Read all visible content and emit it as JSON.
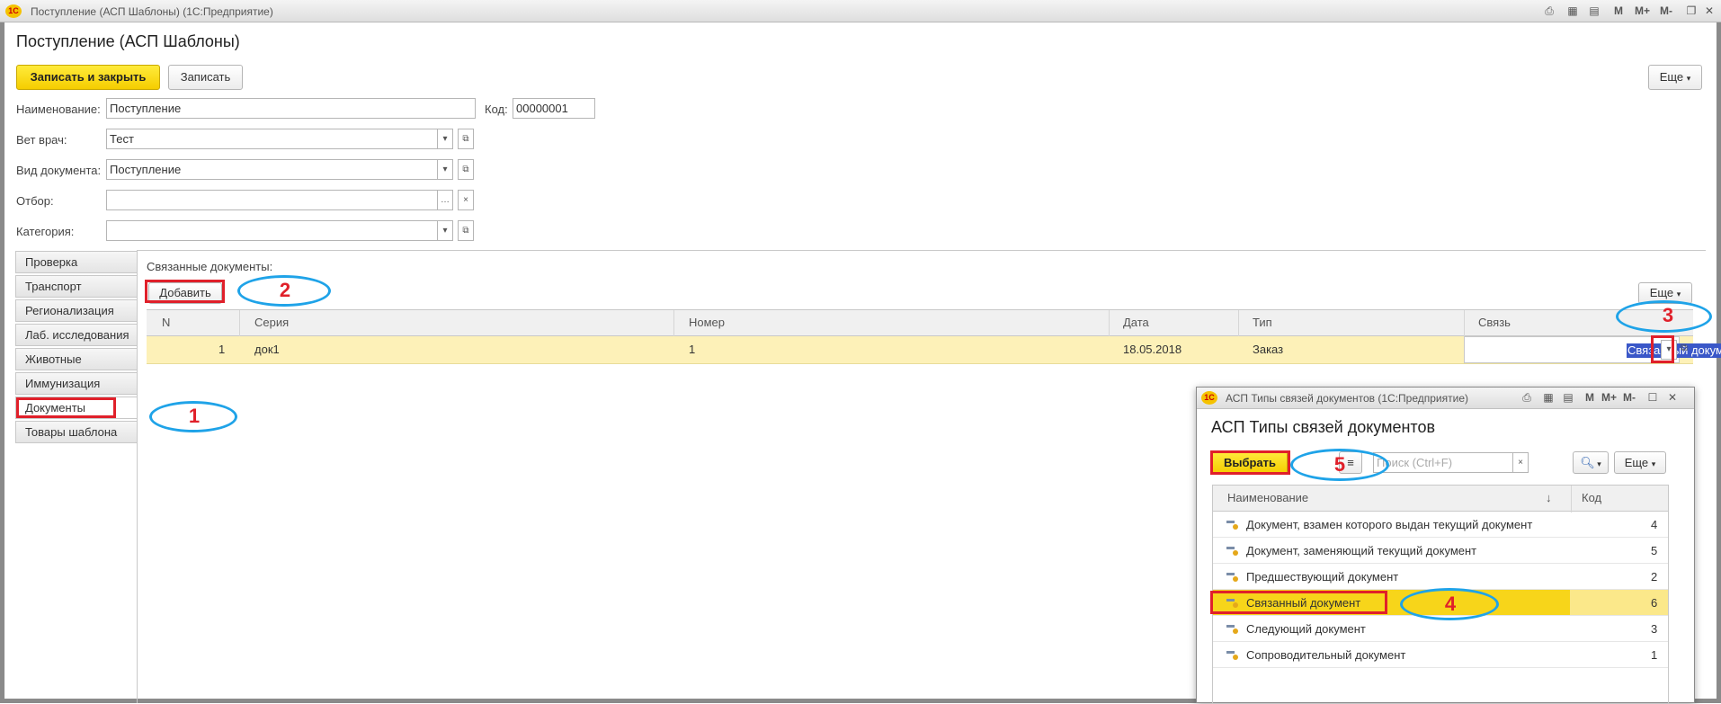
{
  "window": {
    "title": "Поступление (АСП Шаблоны)  (1С:Предприятие)",
    "logo": "1С",
    "toolbar_icons": [
      "print-icon",
      "calculator-icon",
      "calendar-icon"
    ],
    "m_buttons": [
      "M",
      "M+",
      "M-"
    ]
  },
  "form": {
    "title": "Поступление (АСП Шаблоны)",
    "save_close_label": "Записать и закрыть",
    "save_label": "Записать",
    "more_label": "Еще",
    "fields": {
      "name_label": "Наименование:",
      "name_value": "Поступление",
      "code_label": "Код:",
      "code_value": "00000001",
      "vet_label": "Вет врач:",
      "vet_value": "Тест",
      "doctype_label": "Вид документа:",
      "doctype_value": "Поступление",
      "filter_label": "Отбор:",
      "filter_value": "",
      "category_label": "Категория:",
      "category_value": ""
    }
  },
  "sidebar": {
    "items": [
      {
        "label": "Проверка"
      },
      {
        "label": "Транспорт"
      },
      {
        "label": "Регионализация"
      },
      {
        "label": "Лаб. исследования"
      },
      {
        "label": "Животные"
      },
      {
        "label": "Иммунизация"
      },
      {
        "label": "Документы"
      },
      {
        "label": "Товары шаблона"
      }
    ],
    "active_index": 6
  },
  "linked": {
    "section_label": "Связанные документы:",
    "add_label": "Добавить",
    "more_label": "Еще",
    "columns": [
      "N",
      "Серия",
      "Номер",
      "Дата",
      "Тип",
      "Связь"
    ],
    "rows": [
      {
        "n": "1",
        "series": "док1",
        "number": "1",
        "date": "18.05.2018",
        "type": "Заказ",
        "link": "Связанный документ"
      }
    ]
  },
  "popup": {
    "window_title": "АСП Типы связей документов  (1С:Предприятие)",
    "title": "АСП Типы связей документов",
    "select_label": "Выбрать",
    "search_placeholder": "Поиск (Ctrl+F)",
    "more_label": "Еще",
    "columns": [
      "Наименование",
      "Код"
    ],
    "sort_indicator": "↓",
    "items": [
      {
        "name": "Документ, взамен которого выдан текущий документ",
        "code": "4"
      },
      {
        "name": "Документ, заменяющий текущий документ",
        "code": "5"
      },
      {
        "name": "Предшествующий документ",
        "code": "2"
      },
      {
        "name": "Связанный документ",
        "code": "6"
      },
      {
        "name": "Следующий документ",
        "code": "3"
      },
      {
        "name": "Сопроводительный документ",
        "code": "1"
      }
    ],
    "selected_index": 3
  },
  "annotations": {
    "numbers": [
      "1",
      "2",
      "3",
      "4",
      "5"
    ],
    "box_color": "#e0202a",
    "ellipse_color": "#1fa3e8"
  }
}
